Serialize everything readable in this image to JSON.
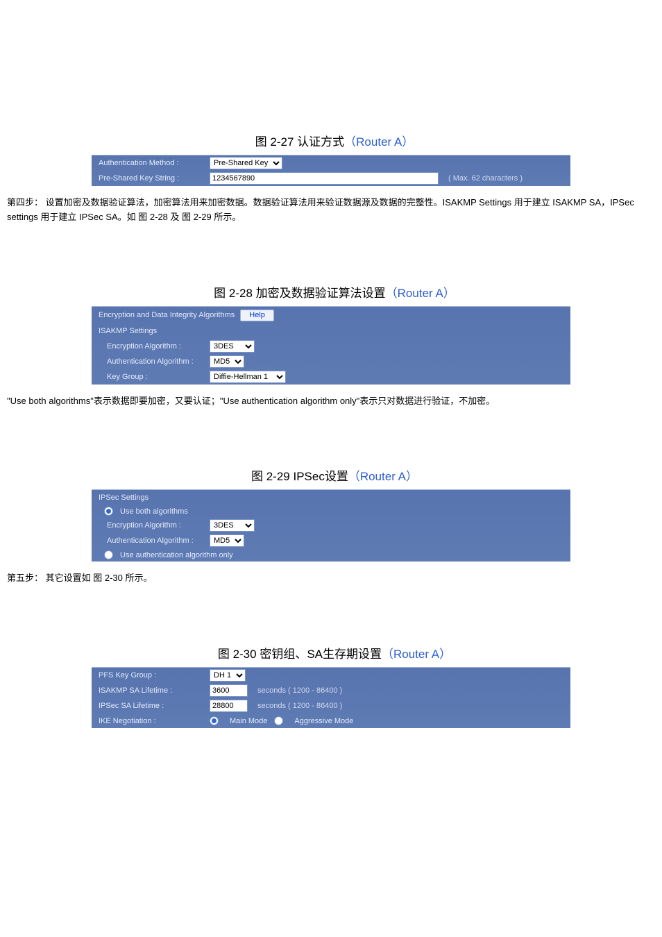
{
  "fig27": {
    "heading_prefix": "图 2-27 认证方式",
    "heading_paren": "（Router A）",
    "panel": {
      "auth_method_label": "Authentication Method :",
      "auth_method_value": "Pre-Shared Key",
      "psk_label": "Pre-Shared Key String :",
      "psk_value": "1234567890",
      "psk_hint": "( Max. 62 characters )"
    },
    "para": "第四步：     设置加密及数据验证算法，加密算法用来加密数据。数据验证算法用来验证数据源及数据的完整性。ISAKMP Settings 用于建立 ISAKMP SA，IPSec settings 用于建立 IPSec SA。如 图 2-28 及 图 2-29 所示。"
  },
  "fig28": {
    "heading_prefix": "图 2-28 加密及数据验证算法设置",
    "heading_paren": "（Router A）",
    "panel": {
      "top_label": "Encryption and Data Integrity Algorithms",
      "help_btn": "Help",
      "isakmp_header": "ISAKMP Settings",
      "enc_label": "Encryption Algorithm :",
      "enc_value": "3DES",
      "auth_label": "Authentication Algorithm :",
      "auth_value": "MD5",
      "keygrp_label": "Key Group :",
      "keygrp_value": "Diffie-Hellman 1"
    },
    "para": "\"Use both algorithms\"表示数据即要加密，又要认证；\"Use authentication algorithm only\"表示只对数据进行验证，不加密。"
  },
  "fig29": {
    "heading_prefix": "图 2-29 IPSec设置",
    "heading_paren": "（Router A）",
    "panel": {
      "ipsec_header": "IPSec Settings",
      "use_both_label": "Use both algorithms",
      "enc_label": "Encryption Algorithm :",
      "enc_value": "3DES",
      "auth_label": "Authentication Algorithm :",
      "auth_value": "MD5",
      "use_auth_only_label": "Use authentication algorithm only"
    },
    "para": "第五步：     其它设置如 图 2-30 所示。"
  },
  "fig30": {
    "heading_prefix": "图 2-30 密钥组、SA生存期设置",
    "heading_paren": "（Router A）",
    "panel": {
      "pfs_label": "PFS Key Group :",
      "pfs_value": "DH 1",
      "isakmp_life_label": "ISAKMP SA Lifetime :",
      "isakmp_life_value": "3600",
      "isakmp_life_hint": "seconds ( 1200 - 86400 )",
      "ipsec_life_label": "IPSec SA Lifetime :",
      "ipsec_life_value": "28800",
      "ipsec_life_hint": "seconds ( 1200 - 86400 )",
      "ike_label": "IKE Negotiation :",
      "ike_main": "Main Mode",
      "ike_aggr": "Aggressive Mode"
    }
  }
}
